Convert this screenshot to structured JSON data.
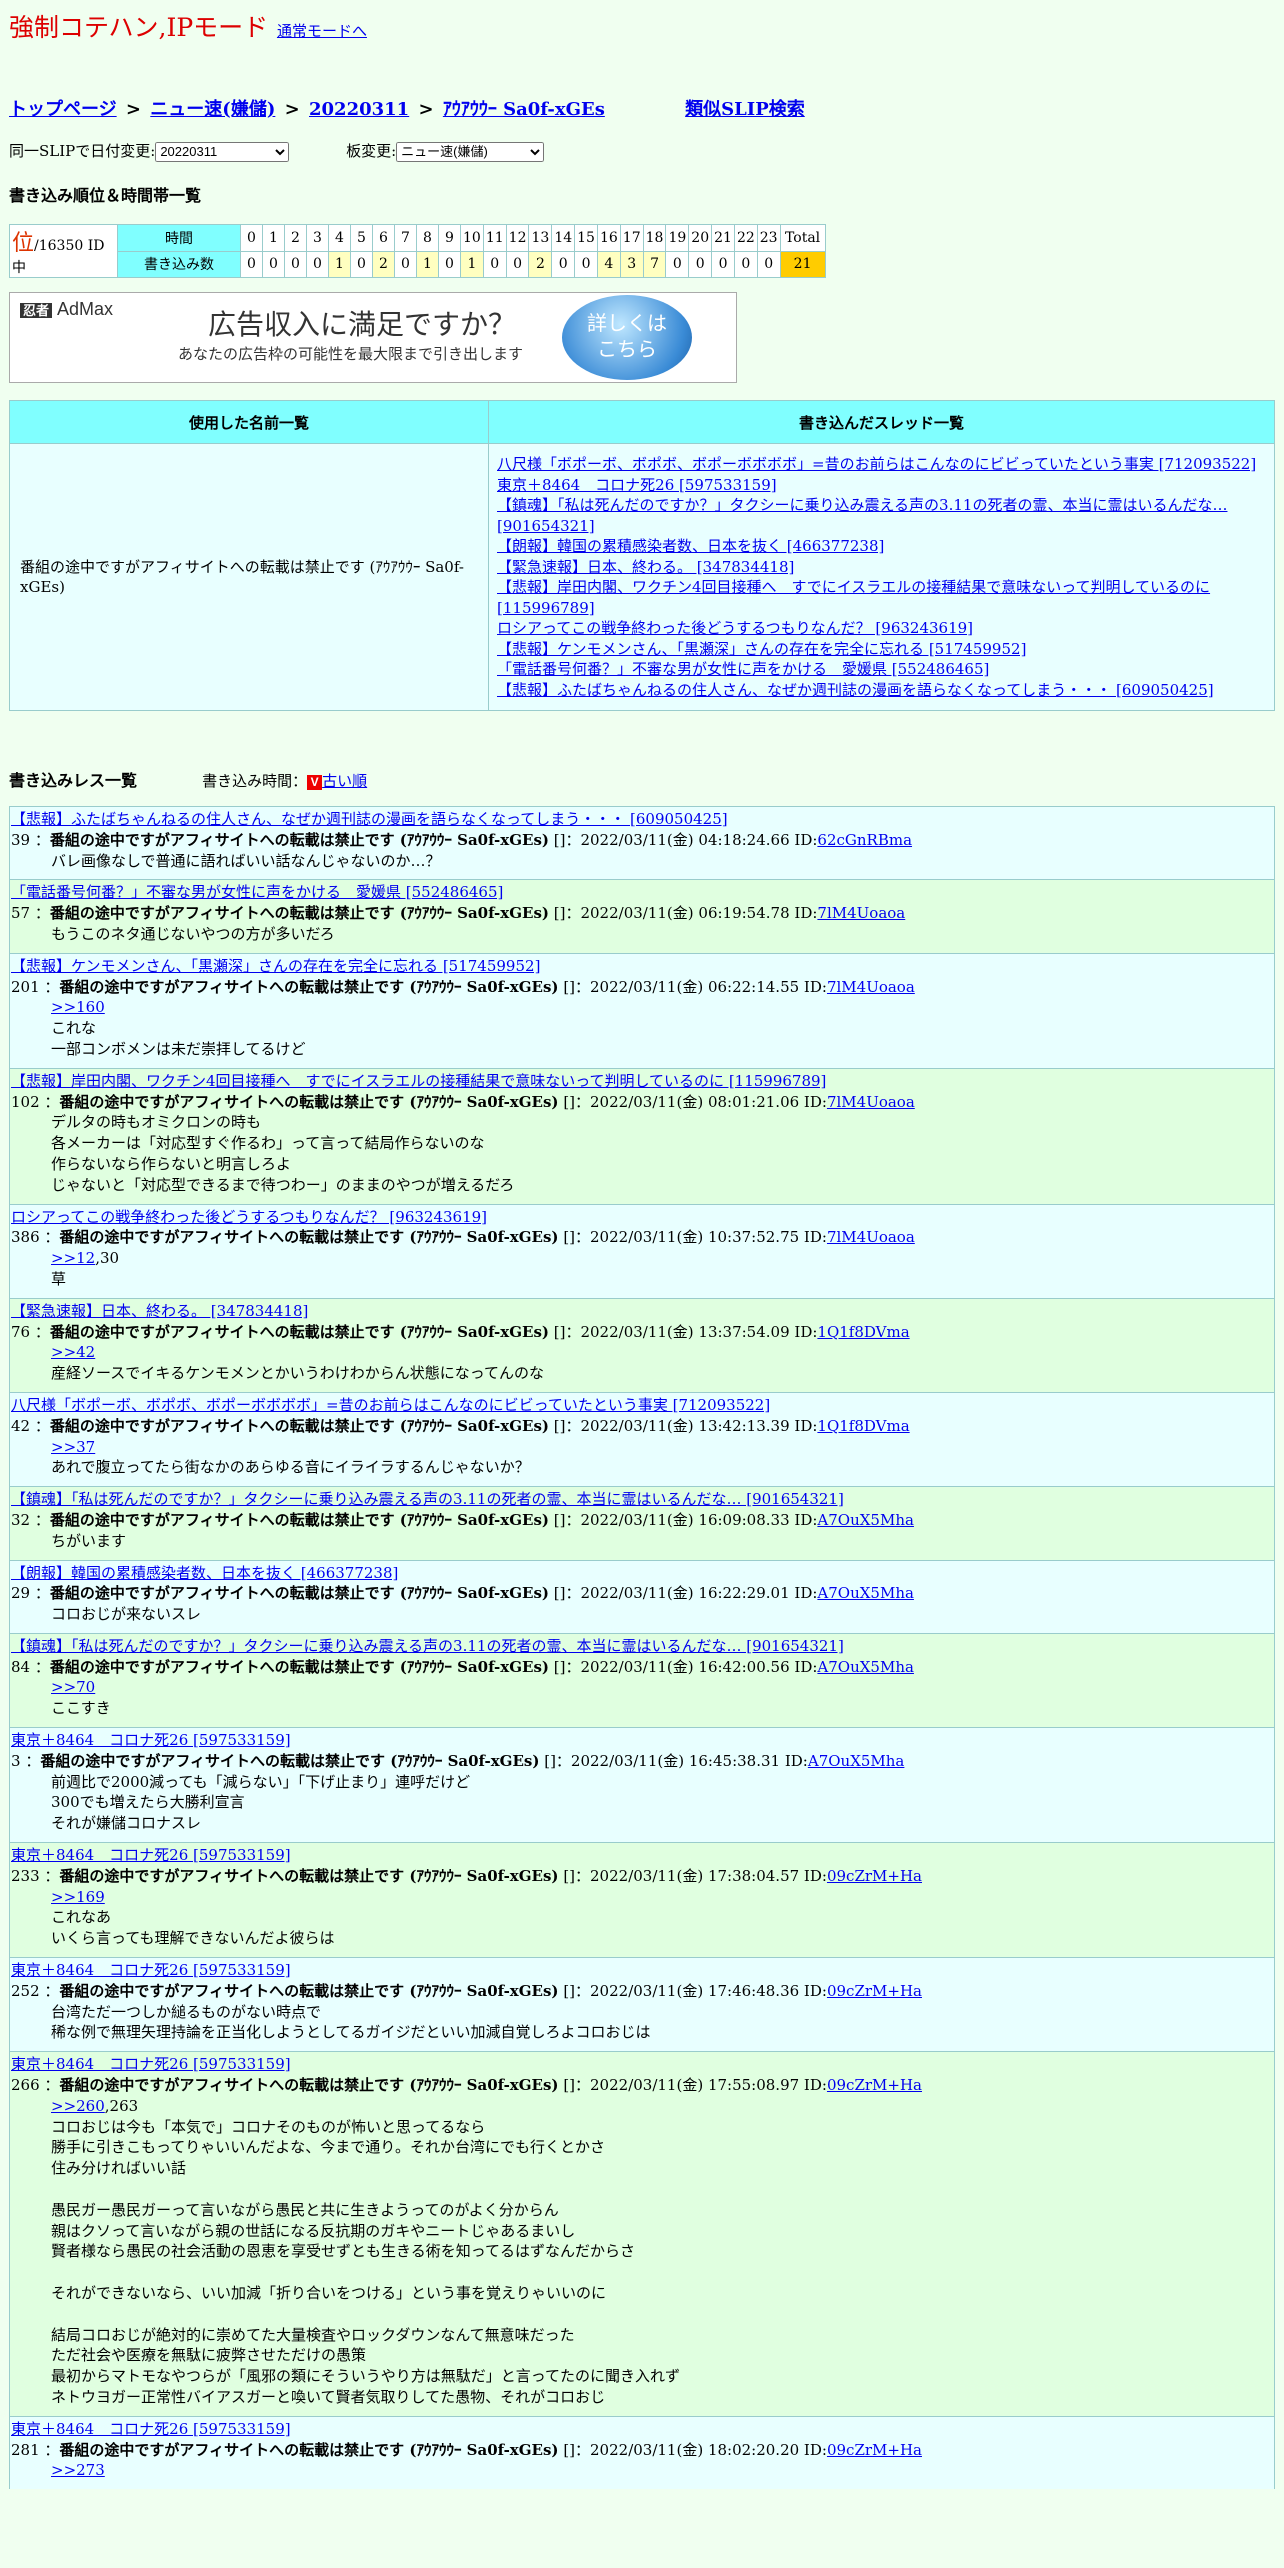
{
  "mode": {
    "title": "強制コテハン,IPモード",
    "normal_link": "通常モードへ"
  },
  "breadcrumb": {
    "top": "トップページ",
    "sep": ">",
    "board": "ニュー速(嫌儲)",
    "date": "20220311",
    "slip": "ｱｳｱｳｳｰ Sa0f-xGEs",
    "similar": "類似SLIP検索"
  },
  "selects": {
    "date_label": "同一SLIPで日付変更:",
    "date_value": "20220311",
    "board_label": "板変更:",
    "board_value": "ニュー速(嫌儲)"
  },
  "rank": {
    "title": "書き込み順位＆時間帯一覧",
    "rank_char": "位",
    "rank_suffix": "/16350 ID中",
    "row_time": "時間",
    "row_count": "書き込み数",
    "hours": [
      "0",
      "1",
      "2",
      "3",
      "4",
      "5",
      "6",
      "7",
      "8",
      "9",
      "10",
      "11",
      "12",
      "13",
      "14",
      "15",
      "16",
      "17",
      "18",
      "19",
      "20",
      "21",
      "22",
      "23"
    ],
    "counts": [
      "0",
      "0",
      "0",
      "0",
      "1",
      "0",
      "2",
      "0",
      "1",
      "0",
      "1",
      "0",
      "0",
      "2",
      "0",
      "0",
      "4",
      "3",
      "7",
      "0",
      "0",
      "0",
      "0",
      "0"
    ],
    "total_label": "Total",
    "total": "21"
  },
  "ad": {
    "logo_pre": "忍者",
    "logo": "AdMax",
    "headline": "広告収入に満足ですか？",
    "sub": "あなたの広告枠の可能性を最大限まで引き出します",
    "badge_1": "詳しくは",
    "badge_2": "こちら"
  },
  "summary": {
    "col_names": "使用した名前一覧",
    "col_threads": "書き込んだスレッド一覧",
    "name": "番組の途中ですがアフィサイトへの転載は禁止です (ｱｳｱｳｳｰ Sa0f-xGEs)",
    "threads": [
      "八尺様「ボポーボ、ボポボ、ボポーボボボボ」=昔のお前らはこんなのにビビっていたという事実 [712093522]",
      "東京＋8464　コロナ死26 [597533159]",
      "【鎮魂】「私は死んだのですか？」タクシーに乗り込み震える声の3.11の死者の霊、本当に霊はいるんだな… [901654321]",
      "【朗報】韓国の累積感染者数、日本を抜く [466377238]",
      "【緊急速報】日本、終わる。 [347834418]",
      "【悲報】岸田内閣、ワクチン4回目接種へ　すでにイスラエルの接種結果で意味ないって判明しているのに [115996789]",
      "ロシアってこの戦争終わった後どうするつもりなんだ？ [963243619]",
      "【悲報】ケンモメンさん、「黒瀬深」さんの存在を完全に忘れる [517459952]",
      "「電話番号何番？」不審な男が女性に声をかける　愛媛県 [552486465]",
      "【悲報】ふたばちゃんねるの住人さん、なぜか週刊誌の漫画を語らなくなってしまう・・・ [609050425]"
    ]
  },
  "posts_header": {
    "title": "書き込みレス一覧",
    "time_label": "書き込み時間：",
    "v": "V",
    "order": "古い順"
  },
  "posts": [
    {
      "thread": "【悲報】ふたばちゃんねるの住人さん、なぜか週刊誌の漫画を語らなくなってしまう・・・ [609050425]",
      "num": "39",
      "name": "番組の途中ですがアフィサイトへの転載は禁止です (ｱｳｱｳｳｰ Sa0f-xGEs)",
      "date": "[]：2022/03/11(金) 04:18:24.66 ID:",
      "id": "62cGnRBma",
      "anchor": "",
      "anchor_rest": "",
      "body": "バレ画像なしで普通に語ればいい話なんじゃないのか…？"
    },
    {
      "thread": "「電話番号何番？」不審な男が女性に声をかける　愛媛県 [552486465]",
      "num": "57",
      "name": "番組の途中ですがアフィサイトへの転載は禁止です (ｱｳｱｳｳｰ Sa0f-xGEs)",
      "date": "[]：2022/03/11(金) 06:19:54.78 ID:",
      "id": "7lM4Uoaoa",
      "anchor": "",
      "anchor_rest": "",
      "body": "もうこのネタ通じないやつの方が多いだろ"
    },
    {
      "thread": "【悲報】ケンモメンさん、「黒瀬深」さんの存在を完全に忘れる [517459952]",
      "num": "201",
      "name": "番組の途中ですがアフィサイトへの転載は禁止です (ｱｳｱｳｳｰ Sa0f-xGEs)",
      "date": "[]：2022/03/11(金) 06:22:14.55 ID:",
      "id": "7lM4Uoaoa",
      "anchor": ">>160",
      "anchor_rest": "",
      "body": "これな\n一部コンボメンは未だ崇拝してるけど"
    },
    {
      "thread": "【悲報】岸田内閣、ワクチン4回目接種へ　すでにイスラエルの接種結果で意味ないって判明しているのに [115996789]",
      "num": "102",
      "name": "番組の途中ですがアフィサイトへの転載は禁止です (ｱｳｱｳｳｰ Sa0f-xGEs)",
      "date": "[]：2022/03/11(金) 08:01:21.06 ID:",
      "id": "7lM4Uoaoa",
      "anchor": "",
      "anchor_rest": "",
      "body": "デルタの時もオミクロンの時も\n各メーカーは「対応型すぐ作るわ」って言って結局作らないのな\n作らないなら作らないと明言しろよ\nじゃないと「対応型できるまで待つわー」のままのやつが増えるだろ"
    },
    {
      "thread": "ロシアってこの戦争終わった後どうするつもりなんだ？ [963243619]",
      "num": "386",
      "name": "番組の途中ですがアフィサイトへの転載は禁止です (ｱｳｱｳｳｰ Sa0f-xGEs)",
      "date": "[]：2022/03/11(金) 10:37:52.75 ID:",
      "id": "7lM4Uoaoa",
      "anchor": ">>12",
      "anchor_rest": ",30",
      "body": "草"
    },
    {
      "thread": "【緊急速報】日本、終わる。 [347834418]",
      "num": "76",
      "name": "番組の途中ですがアフィサイトへの転載は禁止です (ｱｳｱｳｳｰ Sa0f-xGEs)",
      "date": "[]：2022/03/11(金) 13:37:54.09 ID:",
      "id": "1Q1f8DVma",
      "anchor": ">>42",
      "anchor_rest": "",
      "body": "産経ソースでイキるケンモメンとかいうわけわからん状態になってんのな"
    },
    {
      "thread": "八尺様「ボポーボ、ボポボ、ボポーボボボボ」=昔のお前らはこんなのにビビっていたという事実 [712093522]",
      "num": "42",
      "name": "番組の途中ですがアフィサイトへの転載は禁止です (ｱｳｱｳｳｰ Sa0f-xGEs)",
      "date": "[]：2022/03/11(金) 13:42:13.39 ID:",
      "id": "1Q1f8DVma",
      "anchor": ">>37",
      "anchor_rest": "",
      "body": "あれで腹立ってたら街なかのあらゆる音にイライラするんじゃないか？"
    },
    {
      "thread": "【鎮魂】「私は死んだのですか？」タクシーに乗り込み震える声の3.11の死者の霊、本当に霊はいるんだな… [901654321]",
      "num": "32",
      "name": "番組の途中ですがアフィサイトへの転載は禁止です (ｱｳｱｳｳｰ Sa0f-xGEs)",
      "date": "[]：2022/03/11(金) 16:09:08.33 ID:",
      "id": "A7OuX5Mha",
      "anchor": "",
      "anchor_rest": "",
      "body": "ちがいます"
    },
    {
      "thread": "【朗報】韓国の累積感染者数、日本を抜く [466377238]",
      "num": "29",
      "name": "番組の途中ですがアフィサイトへの転載は禁止です (ｱｳｱｳｳｰ Sa0f-xGEs)",
      "date": "[]：2022/03/11(金) 16:22:29.01 ID:",
      "id": "A7OuX5Mha",
      "anchor": "",
      "anchor_rest": "",
      "body": "コロおじが来ないスレ"
    },
    {
      "thread": "【鎮魂】「私は死んだのですか？」タクシーに乗り込み震える声の3.11の死者の霊、本当に霊はいるんだな… [901654321]",
      "num": "84",
      "name": "番組の途中ですがアフィサイトへの転載は禁止です (ｱｳｱｳｳｰ Sa0f-xGEs)",
      "date": "[]：2022/03/11(金) 16:42:00.56 ID:",
      "id": "A7OuX5Mha",
      "anchor": ">>70",
      "anchor_rest": "",
      "body": "ここすき"
    },
    {
      "thread": "東京＋8464　コロナ死26 [597533159]",
      "num": "3",
      "name": "番組の途中ですがアフィサイトへの転載は禁止です (ｱｳｱｳｳｰ Sa0f-xGEs)",
      "date": "[]：2022/03/11(金) 16:45:38.31 ID:",
      "id": "A7OuX5Mha",
      "anchor": "",
      "anchor_rest": "",
      "body": "前週比で2000減っても「減らない」「下げ止まり」連呼だけど\n300でも増えたら大勝利宣言\nそれが嫌儲コロナスレ"
    },
    {
      "thread": "東京＋8464　コロナ死26 [597533159]",
      "num": "233",
      "name": "番組の途中ですがアフィサイトへの転載は禁止です (ｱｳｱｳｳｰ Sa0f-xGEs)",
      "date": "[]：2022/03/11(金) 17:38:04.57 ID:",
      "id": "09cZrM+Ha",
      "anchor": ">>169",
      "anchor_rest": "",
      "body": "これなあ\nいくら言っても理解できないんだよ彼らは"
    },
    {
      "thread": "東京＋8464　コロナ死26 [597533159]",
      "num": "252",
      "name": "番組の途中ですがアフィサイトへの転載は禁止です (ｱｳｱｳｳｰ Sa0f-xGEs)",
      "date": "[]：2022/03/11(金) 17:46:48.36 ID:",
      "id": "09cZrM+Ha",
      "anchor": "",
      "anchor_rest": "",
      "body": "台湾ただ一つしか縋るものがない時点で\n稀な例で無理矢理持論を正当化しようとしてるガイジだといい加減自覚しろよコロおじは"
    },
    {
      "thread": "東京＋8464　コロナ死26 [597533159]",
      "num": "266",
      "name": "番組の途中ですがアフィサイトへの転載は禁止です (ｱｳｱｳｳｰ Sa0f-xGEs)",
      "date": "[]：2022/03/11(金) 17:55:08.97 ID:",
      "id": "09cZrM+Ha",
      "anchor": ">>260",
      "anchor_rest": ",263",
      "body": "コロおじは今も「本気で」コロナそのものが怖いと思ってるなら\n勝手に引きこもってりゃいいんだよな、今まで通り。それか台湾にでも行くとかさ\n住み分ければいい話\n\n愚民ガー愚民ガーって言いながら愚民と共に生きようってのがよく分からん\n親はクソって言いながら親の世話になる反抗期のガキやニートじゃあるまいし\n賢者様なら愚民の社会活動の恩恵を享受せずとも生きる術を知ってるはずなんだからさ\n\nそれができないなら、いい加減「折り合いをつける」という事を覚えりゃいいのに\n\n結局コロおじが絶対的に崇めてた大量検査やロックダウンなんて無意味だった\nただ社会や医療を無駄に疲弊させただけの愚策\n最初からマトモなやつらが「風邪の類にそういうやり方は無駄だ」と言ってたのに聞き入れず\nネトウヨガー正常性バイアスガーと喚いて賢者気取りしてた愚物、それがコロおじ"
    },
    {
      "thread": "東京＋8464　コロナ死26 [597533159]",
      "num": "281",
      "name": "番組の途中ですがアフィサイトへの転載は禁止です (ｱｳｱｳｳｰ Sa0f-xGEs)",
      "date": "[]：2022/03/11(金) 18:02:20.20 ID:",
      "id": "09cZrM+Ha",
      "anchor": ">>273",
      "anchor_rest": "",
      "body": ""
    }
  ]
}
